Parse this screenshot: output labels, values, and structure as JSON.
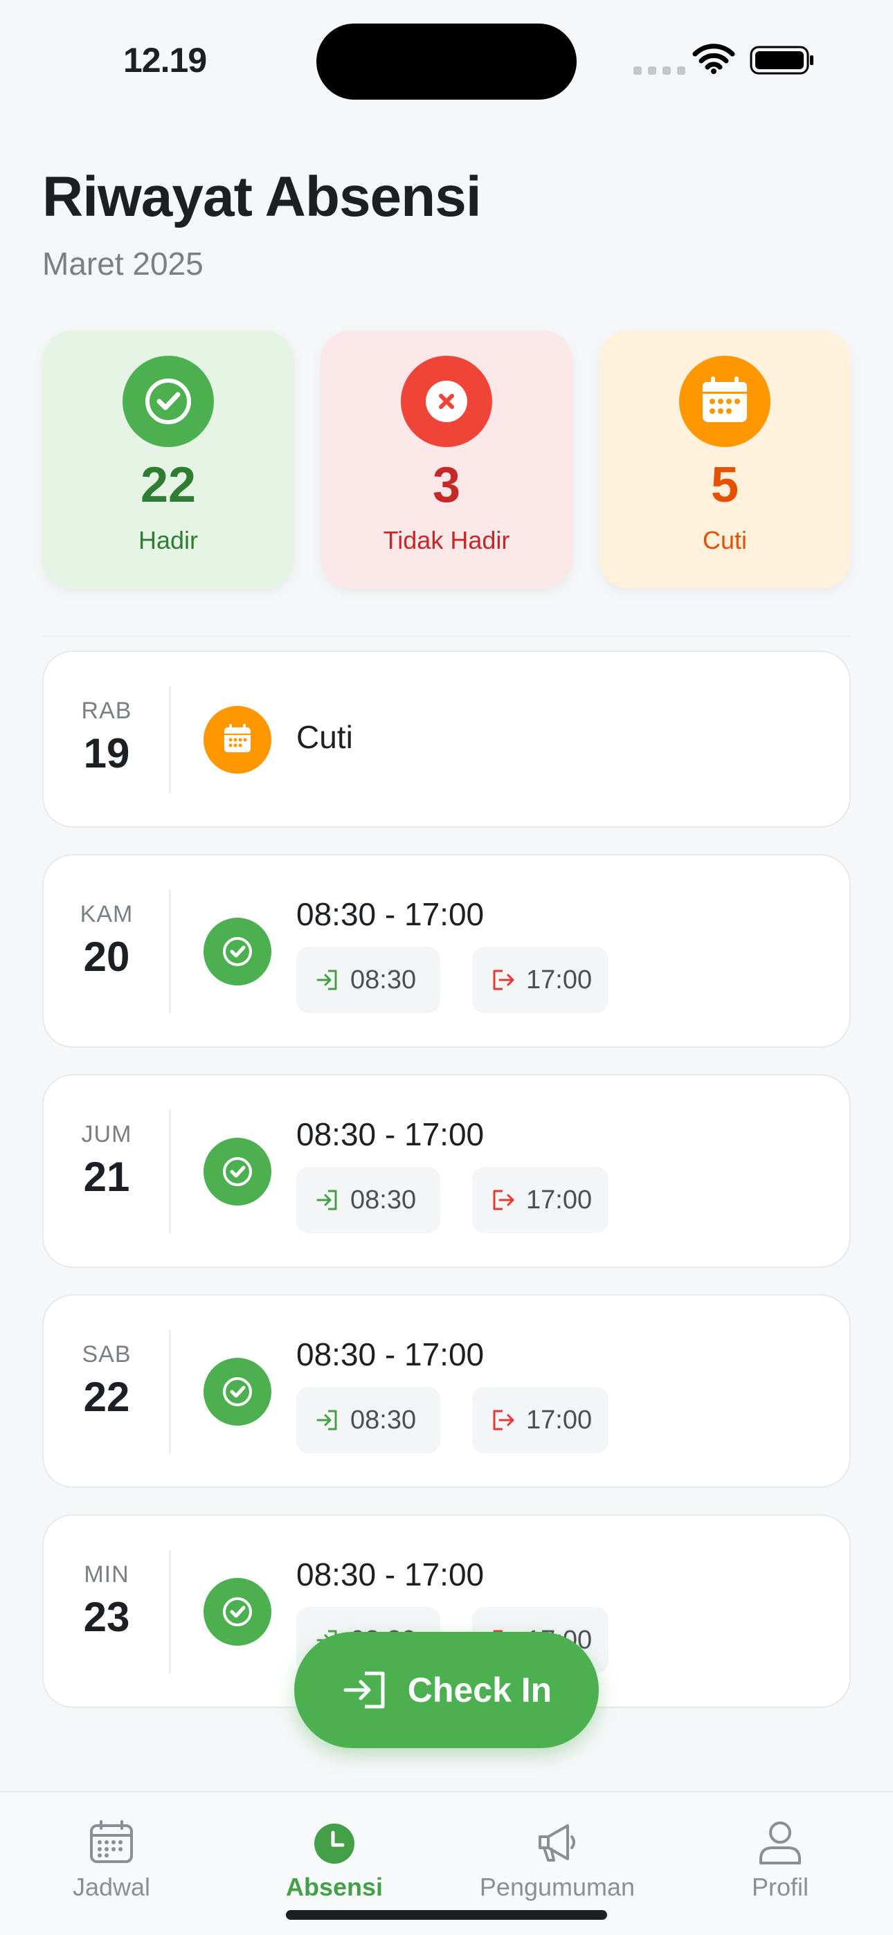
{
  "status_bar": {
    "time": "12.19"
  },
  "header": {
    "title": "Riwayat Absensi",
    "subtitle": "Maret 2025"
  },
  "summary": [
    {
      "count": "22",
      "label": "Hadir",
      "icon": "check-icon",
      "color": "#4caf50"
    },
    {
      "count": "3",
      "label": "Tidak Hadir",
      "icon": "close-icon",
      "color": "#f04438"
    },
    {
      "count": "5",
      "label": "Cuti",
      "icon": "calendar-icon",
      "color": "#ff9800"
    }
  ],
  "records": [
    {
      "day": "RAB",
      "date": "19",
      "status": "leave",
      "title": "Cuti"
    },
    {
      "day": "KAM",
      "date": "20",
      "status": "present",
      "title": "08:30 - 17:00",
      "check_in": "08:30",
      "check_out": "17:00"
    },
    {
      "day": "JUM",
      "date": "21",
      "status": "present",
      "title": "08:30 - 17:00",
      "check_in": "08:30",
      "check_out": "17:00"
    },
    {
      "day": "SAB",
      "date": "22",
      "status": "present",
      "title": "08:30 - 17:00",
      "check_in": "08:30",
      "check_out": "17:00"
    },
    {
      "day": "MIN",
      "date": "23",
      "status": "present",
      "title": "08:30 - 17:00",
      "check_in": "08:30",
      "check_out": "17:00"
    }
  ],
  "checkin_button": {
    "label": "Check In"
  },
  "tabs": [
    {
      "label": "Jadwal",
      "icon": "calendar-icon",
      "active": false
    },
    {
      "label": "Absensi",
      "icon": "clock-icon",
      "active": true
    },
    {
      "label": "Pengumuman",
      "icon": "megaphone-icon",
      "active": false
    },
    {
      "label": "Profil",
      "icon": "person-icon",
      "active": false
    }
  ],
  "colors": {
    "accent": "#4caf50",
    "absent": "#f04438",
    "leave": "#ff9800",
    "check_out_icon": "#e53935"
  }
}
